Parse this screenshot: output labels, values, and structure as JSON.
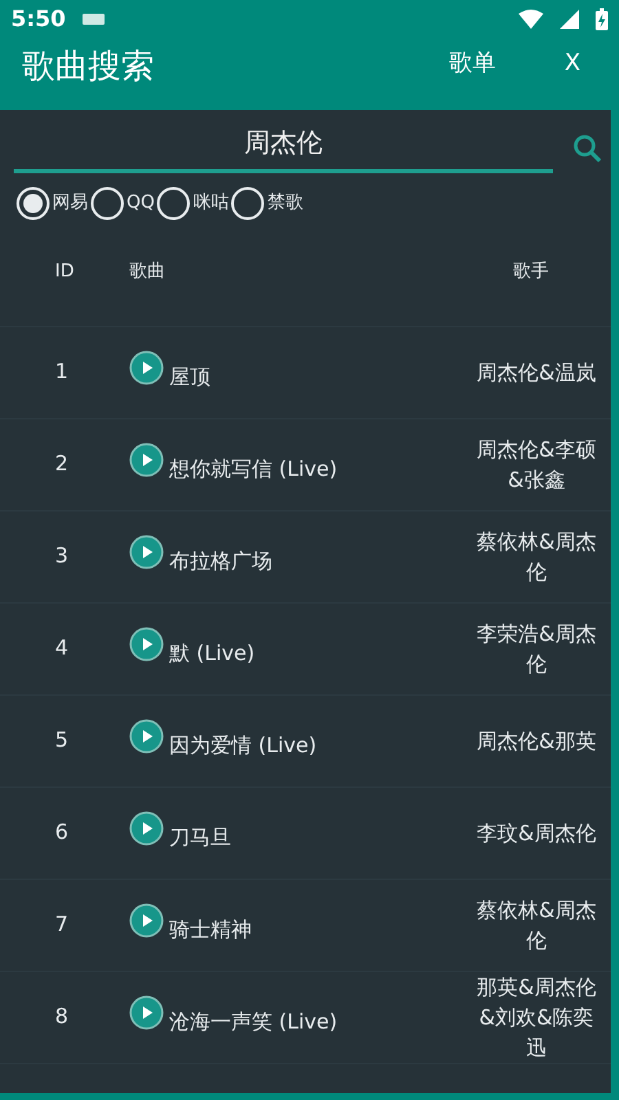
{
  "status_bar": {
    "time": "5:50"
  },
  "dialog": {
    "title": "歌曲搜索",
    "actions": [
      "歌单",
      "X"
    ]
  },
  "search": {
    "value": "周杰伦"
  },
  "sources": [
    {
      "label": "网易",
      "selected": true
    },
    {
      "label": "QQ",
      "selected": false
    },
    {
      "label": "咪咕",
      "selected": false
    },
    {
      "label": "禁歌",
      "selected": false
    }
  ],
  "table": {
    "columns": [
      "ID",
      "歌曲",
      "歌手"
    ],
    "rows": [
      {
        "id": "1",
        "song": "屋顶",
        "artist": "周杰伦&温岚"
      },
      {
        "id": "2",
        "song": "想你就写信 (Live)",
        "artist": "周杰伦&李硕&张鑫"
      },
      {
        "id": "3",
        "song": "布拉格广场",
        "artist": "蔡依林&周杰伦"
      },
      {
        "id": "4",
        "song": "默 (Live)",
        "artist": "李荣浩&周杰伦"
      },
      {
        "id": "5",
        "song": "因为爱情 (Live)",
        "artist": "周杰伦&那英"
      },
      {
        "id": "6",
        "song": "刀马旦",
        "artist": "李玟&周杰伦"
      },
      {
        "id": "7",
        "song": "骑士精神",
        "artist": "蔡依林&周杰伦"
      },
      {
        "id": "8",
        "song": "沧海一声笑 (Live)",
        "artist": "那英&周杰伦&刘欢&陈奕迅"
      }
    ]
  }
}
